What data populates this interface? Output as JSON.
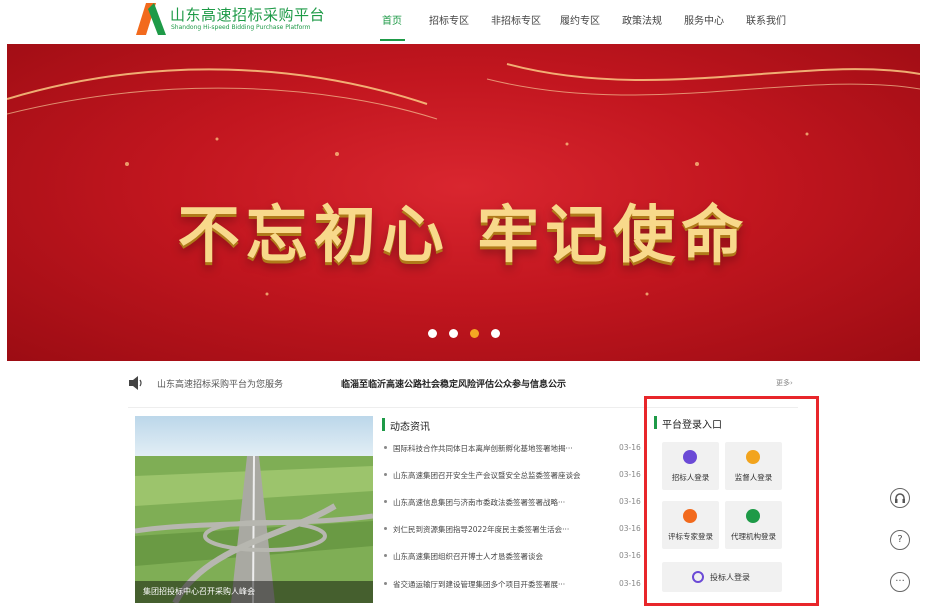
{
  "header": {
    "logo_title": "山东高速招标采购平台",
    "logo_subtitle": "Shandong Hi-speed Bidding Purchase Platform",
    "nav": [
      "首页",
      "招标专区",
      "非招标专区",
      "履约专区",
      "政策法规",
      "服务中心",
      "联系我们"
    ],
    "active_nav": "首页",
    "brand_color": "#1e9a47"
  },
  "banner": {
    "slogan": "不忘初心 牢记使命",
    "slide_count": 4,
    "active_slide": 3
  },
  "notice": {
    "service_text": "山东高速招标采购平台为您服务",
    "headline": "临淄至临沂高速公路社会稳定风险评估公众参与信息公示",
    "more": "更多›"
  },
  "news": {
    "photo_caption": "集团招投标中心召开采购人峰会",
    "section_title": "动态资讯",
    "items": [
      {
        "text": "国际科技合作共同体日本离岸创新孵化基地签署地揭···",
        "date": "03-16"
      },
      {
        "text": "山东高速集团召开安全生产会议暨安全总监委签署座谈会",
        "date": "03-16"
      },
      {
        "text": "山东高速信息集团与济南市委政法委签署签署战略···",
        "date": "03-16"
      },
      {
        "text": "刘仁民到资源集团指导2022年度民主委签署生活会···",
        "date": "03-16"
      },
      {
        "text": "山东高速集团组织召开博士人才恳委签署谈会",
        "date": "03-16"
      },
      {
        "text": "省交通运输厅到建设管理集团多个项目开委签署展···",
        "date": "03-16"
      }
    ]
  },
  "login": {
    "section_title": "平台登录入口",
    "buttons": [
      {
        "label": "招标人登录",
        "icon": "gavel-icon",
        "color": "#6b4ad6"
      },
      {
        "label": "监督人登录",
        "icon": "supervisor-icon",
        "color": "#f2a41d"
      },
      {
        "label": "评标专家登录",
        "icon": "expert-icon",
        "color": "#f26a1d"
      },
      {
        "label": "代理机构登录",
        "icon": "agency-icon",
        "color": "#1e9a47"
      }
    ],
    "wide_button": {
      "label": "投标人登录",
      "icon": "bidder-icon",
      "color": "#6b4ad6"
    }
  },
  "float_buttons": [
    "headset-icon",
    "help-icon",
    "chat-icon"
  ]
}
